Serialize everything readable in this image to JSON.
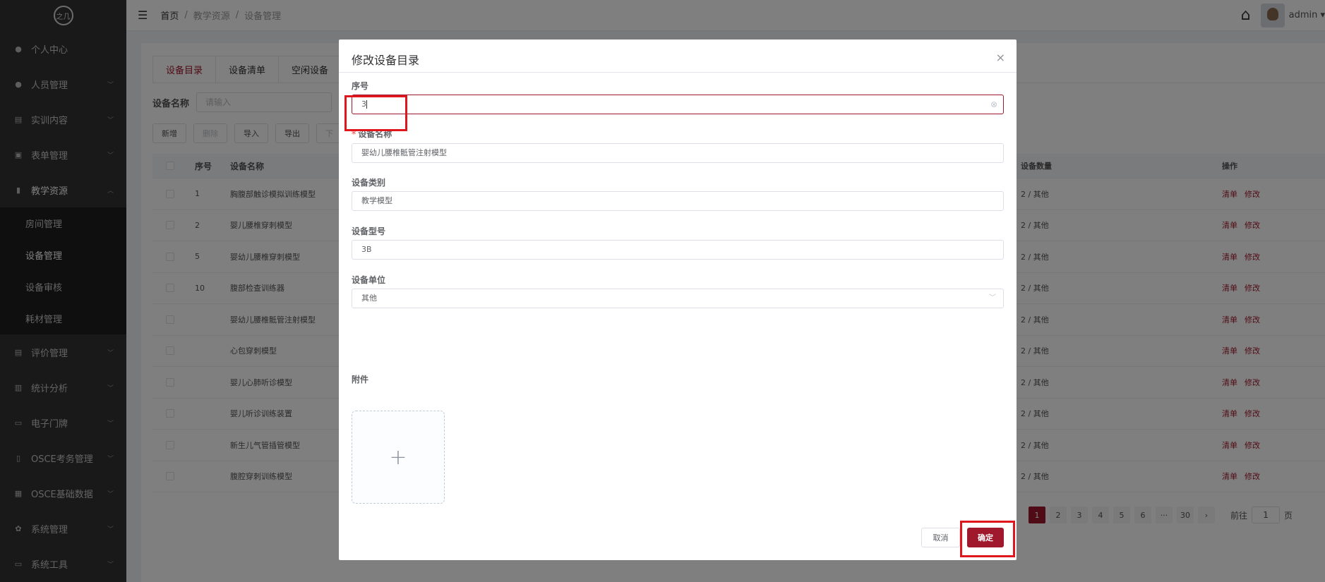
{
  "sidebar": {
    "logo": "之几",
    "items": [
      {
        "label": "个人中心",
        "icon": "user-icon",
        "glyph": "●",
        "arrow": false
      },
      {
        "label": "人员管理",
        "icon": "users-icon",
        "glyph": "●",
        "arrow": true
      },
      {
        "label": "实训内容",
        "icon": "doc-icon",
        "glyph": "▤",
        "arrow": true
      },
      {
        "label": "表单管理",
        "icon": "form-icon",
        "glyph": "▣",
        "arrow": true
      },
      {
        "label": "教学资源",
        "icon": "book-icon",
        "glyph": "▮",
        "arrow": true,
        "active": true
      }
    ],
    "submenu": [
      "房间管理",
      "设备管理",
      "设备审核",
      "耗材管理"
    ],
    "submenu_active": 1,
    "items_after": [
      {
        "label": "评价管理",
        "icon": "eval-icon",
        "glyph": "▤",
        "arrow": true
      },
      {
        "label": "统计分析",
        "icon": "bar-chart-icon",
        "glyph": "▥",
        "arrow": true
      },
      {
        "label": "电子门牌",
        "icon": "monitor-icon",
        "glyph": "▭",
        "arrow": true
      },
      {
        "label": "OSCE考务管理",
        "icon": "exam-icon",
        "glyph": "▯",
        "arrow": true
      },
      {
        "label": "OSCE基础数据",
        "icon": "grid-icon",
        "glyph": "▦",
        "arrow": true
      },
      {
        "label": "系统管理",
        "icon": "gear-icon",
        "glyph": "✿",
        "arrow": true
      },
      {
        "label": "系统工具",
        "icon": "tool-icon",
        "glyph": "▭",
        "arrow": true
      }
    ]
  },
  "header": {
    "breadcrumb": [
      "首页",
      "教学资源",
      "设备管理"
    ],
    "user": "admin ▾"
  },
  "main": {
    "tabs": [
      "设备目录",
      "设备清单",
      "空闲设备"
    ],
    "search_label": "设备名称",
    "search_placeholder": "请输入",
    "toolbar": [
      "新增",
      "删除",
      "导入",
      "导出",
      "下"
    ],
    "table": {
      "headers": [
        "序号",
        "设备名称",
        "设备数量",
        "操作"
      ],
      "rows": [
        {
          "no": "1",
          "name": "胸腹部触诊模拟训练模型",
          "qty": "2 / 其他"
        },
        {
          "no": "2",
          "name": "婴儿腰椎穿刺模型",
          "qty": "2 / 其他"
        },
        {
          "no": "5",
          "name": "婴幼儿腰椎穿刺模型",
          "qty": "2 / 其他"
        },
        {
          "no": "10",
          "name": "腹部检查训练器",
          "qty": "2 / 其他"
        },
        {
          "no": "",
          "name": "婴幼儿腰椎骶管注射模型",
          "qty": "2 / 其他"
        },
        {
          "no": "",
          "name": "心包穿刺模型",
          "qty": "2 / 其他"
        },
        {
          "no": "",
          "name": "婴儿心肺听诊模型",
          "qty": "2 / 其他"
        },
        {
          "no": "",
          "name": "婴儿听诊训练装置",
          "qty": "2 / 其他"
        },
        {
          "no": "",
          "name": "新生儿气管插管模型",
          "qty": "2 / 其他"
        },
        {
          "no": "",
          "name": "腹腔穿刺训练模型",
          "qty": "2 / 其他"
        }
      ],
      "op_list": "清单",
      "op_edit": "修改"
    },
    "pager": {
      "pages": [
        "1",
        "2",
        "3",
        "4",
        "5",
        "6",
        "···",
        "30",
        "›"
      ],
      "active": 0,
      "goto_label": "前往",
      "goto_value": "1",
      "goto_suffix": "页"
    }
  },
  "dialog": {
    "title": "修改设备目录",
    "close": "×",
    "fields": [
      {
        "label": "序号",
        "value": "3",
        "required": false,
        "type": "text",
        "focus": true
      },
      {
        "label": "设备名称",
        "value": "婴幼儿腰椎骶管注射模型",
        "required": true,
        "type": "text"
      },
      {
        "label": "设备类别",
        "value": "教学模型",
        "required": false,
        "type": "text"
      },
      {
        "label": "设备型号",
        "value": "3B",
        "required": false,
        "type": "text"
      },
      {
        "label": "设备单位",
        "value": "其他",
        "required": false,
        "type": "select"
      }
    ],
    "attachment_label": "附件",
    "cancel": "取消",
    "ok": "确定"
  },
  "colors": {
    "brand": "#a0182c",
    "sidebar": "#333335",
    "highlight": "#e0161d"
  }
}
